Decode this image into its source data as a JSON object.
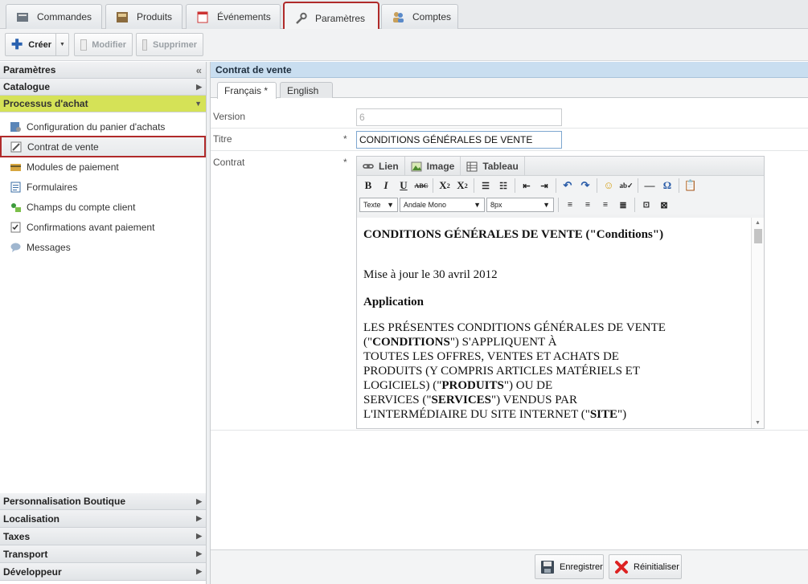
{
  "top_tabs": [
    {
      "label": "Commandes",
      "icon": "orders-icon"
    },
    {
      "label": "Produits",
      "icon": "box-icon"
    },
    {
      "label": "Événements",
      "icon": "calendar-icon"
    },
    {
      "label": "Paramètres",
      "icon": "wrench-icon"
    },
    {
      "label": "Comptes",
      "icon": "users-icon"
    }
  ],
  "toolbar": {
    "create": "Créer",
    "modify": "Modifier",
    "delete": "Supprimer"
  },
  "sidebar": {
    "title": "Paramètres",
    "sections_top": [
      "Catalogue",
      "Processus d'achat"
    ],
    "items": [
      "Configuration du panier d'achats",
      "Contrat de vente",
      "Modules de paiement",
      "Formulaires",
      "Champs du compte client",
      "Confirmations avant paiement",
      "Messages"
    ],
    "sections_bottom": [
      "Personnalisation Boutique",
      "Localisation",
      "Taxes",
      "Transport",
      "Développeur"
    ]
  },
  "main": {
    "title": "Contrat de vente",
    "lang_tabs": [
      "Français *",
      "English"
    ],
    "fields": {
      "version_label": "Version",
      "version_value": "6",
      "title_label": "Titre",
      "title_value": "CONDITIONS GÉNÉRALES DE VENTE",
      "contract_label": "Contrat",
      "required": "*"
    }
  },
  "editor": {
    "tabs": [
      "Lien",
      "Image",
      "Tableau"
    ],
    "format_select": "Texte",
    "font_select": "Andale Mono",
    "size_select": "8px",
    "content": {
      "heading": "CONDITIONS GÉNÉRALES DE VENTE (\"Conditions\")",
      "updated": "Mise à jour le 30 avril 2012",
      "section": "Application",
      "p1": "LES PRÉSENTES CONDITIONS GÉNÉRALES DE VENTE",
      "p2a": "(\"",
      "p2b": "CONDITIONS",
      "p2c": "\") S'APPLIQUENT À",
      "p3": "TOUTES LES OFFRES, VENTES ET ACHATS DE",
      "p4": "PRODUITS (Y COMPRIS ARTICLES MATÉRIELS ET",
      "p5a": "LOGICIELS) (\"",
      "p5b": "PRODUITS",
      "p5c": "\") OU DE",
      "p6a": "SERVICES (\"",
      "p6b": "SERVICES",
      "p6c": "\") VENDUS PAR",
      "p7a": "L'INTERMÉDIAIRE DU SITE INTERNET (\"",
      "p7b": "SITE",
      "p7c": "\")"
    }
  },
  "buttons": {
    "save": "Enregistrer",
    "reset": "Réinitialiser"
  }
}
